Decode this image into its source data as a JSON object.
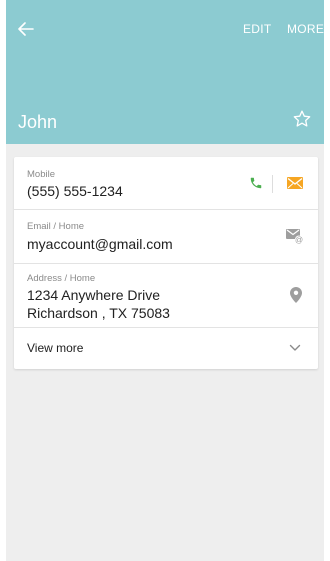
{
  "toolbar": {
    "edit_label": "EDIT",
    "more_label": "MORE"
  },
  "contact": {
    "name": "John"
  },
  "fields": {
    "mobile": {
      "label": "Mobile",
      "value": "(555) 555-1234"
    },
    "email": {
      "label": "Email / Home",
      "value": "myaccount@gmail.com"
    },
    "address": {
      "label": "Address / Home",
      "line1": "1234 Anywhere Drive",
      "line2": "Richardson , TX 75083"
    }
  },
  "view_more": {
    "label": "View more"
  },
  "icons": {
    "back": "back-arrow-icon",
    "favorite": "star-outline-icon",
    "call": "phone-icon",
    "message": "message-icon",
    "email": "email-icon",
    "map": "location-pin-icon",
    "expand": "chevron-down-icon"
  },
  "colors": {
    "header": "#8ccbd1",
    "call": "#4caf50",
    "message": "#f6a623",
    "background": "#eeeeee"
  }
}
